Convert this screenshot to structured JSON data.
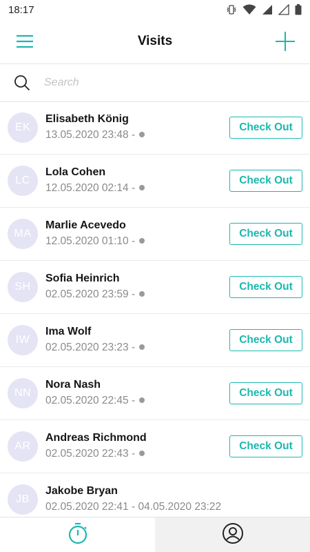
{
  "status_bar": {
    "time": "18:17"
  },
  "app_bar": {
    "title": "Visits",
    "menu_icon": "hamburger-menu-icon",
    "add_icon": "plus-icon"
  },
  "search": {
    "placeholder": "Search",
    "value": ""
  },
  "colors": {
    "accent": "#1ab8b0",
    "avatar_bg": "#e4e4f5",
    "secondary_text": "#8a8a8a"
  },
  "visits": [
    {
      "initials": "EK",
      "name": "Elisabeth König",
      "date": "13.05.2020 23:48 - ",
      "open": true,
      "action": "Check Out"
    },
    {
      "initials": "LC",
      "name": "Lola Cohen",
      "date": "12.05.2020 02:14 - ",
      "open": true,
      "action": "Check Out"
    },
    {
      "initials": "MA",
      "name": "Marlie Acevedo",
      "date": "12.05.2020 01:10 - ",
      "open": true,
      "action": "Check Out"
    },
    {
      "initials": "SH",
      "name": "Sofia Heinrich",
      "date": "02.05.2020 23:59 - ",
      "open": true,
      "action": "Check Out"
    },
    {
      "initials": "IW",
      "name": "Ima Wolf",
      "date": "02.05.2020 23:23 - ",
      "open": true,
      "action": "Check Out"
    },
    {
      "initials": "NN",
      "name": "Nora Nash",
      "date": "02.05.2020 22:45 - ",
      "open": true,
      "action": "Check Out"
    },
    {
      "initials": "AR",
      "name": "Andreas Richmond",
      "date": "02.05.2020 22:43 - ",
      "open": true,
      "action": "Check Out"
    },
    {
      "initials": "JB",
      "name": "Jakobe Bryan",
      "date": "02.05.2020 22:41 - 04.05.2020 23:22",
      "open": false,
      "action": ""
    }
  ],
  "bottom_nav": [
    {
      "icon": "stopwatch-icon",
      "active": true
    },
    {
      "icon": "profile-icon",
      "active": false
    }
  ]
}
